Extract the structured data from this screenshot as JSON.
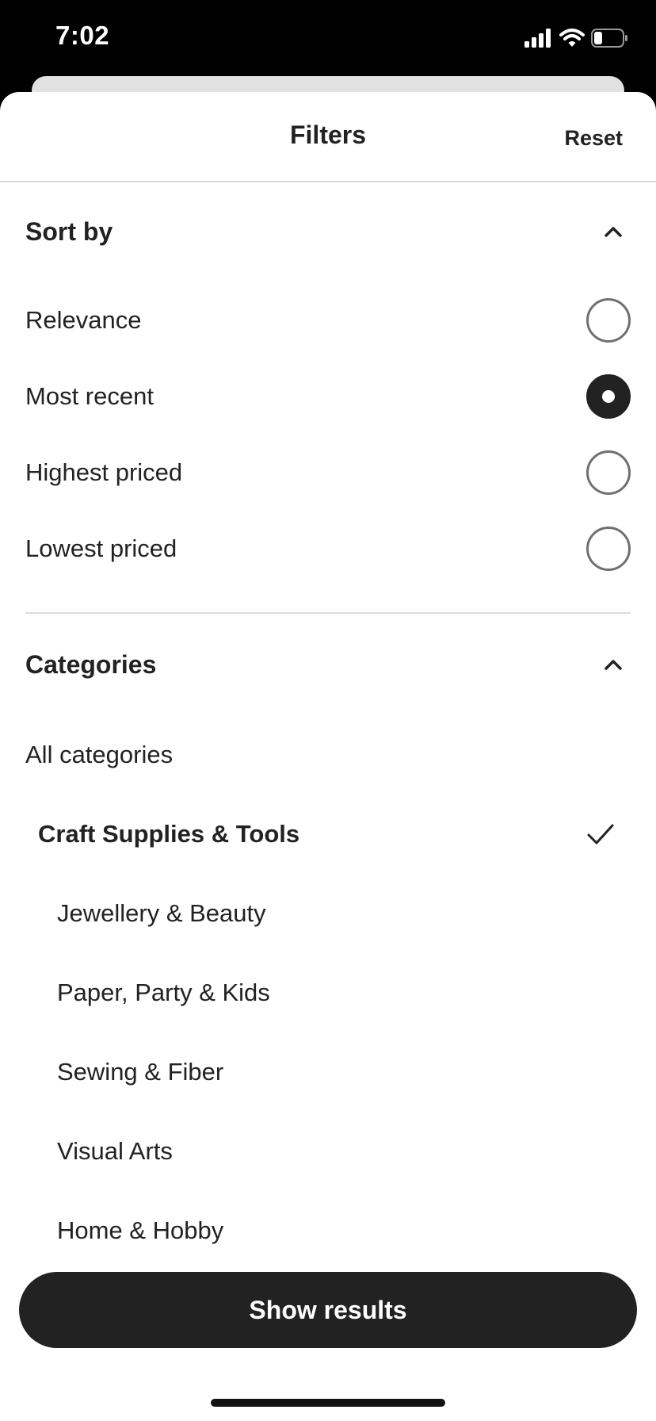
{
  "status_bar": {
    "time": "7:02",
    "icons": [
      "cellular-signal-icon",
      "wifi-icon",
      "battery-icon"
    ]
  },
  "sheet": {
    "title": "Filters",
    "reset_label": "Reset"
  },
  "sort_by": {
    "title": "Sort by",
    "expanded": true,
    "options": [
      {
        "label": "Relevance",
        "selected": false
      },
      {
        "label": "Most recent",
        "selected": true
      },
      {
        "label": "Highest priced",
        "selected": false
      },
      {
        "label": "Lowest priced",
        "selected": false
      }
    ]
  },
  "categories": {
    "title": "Categories",
    "expanded": true,
    "all_label": "All categories",
    "selected_label": "Craft Supplies & Tools",
    "subcategories": [
      "Jewellery & Beauty",
      "Paper, Party & Kids",
      "Sewing & Fiber",
      "Visual Arts",
      "Home & Hobby"
    ]
  },
  "footer": {
    "show_results_label": "Show results"
  },
  "colors": {
    "primary": "#222222",
    "background": "#ffffff",
    "divider": "#dcdcdc",
    "radio_border": "#707070"
  }
}
